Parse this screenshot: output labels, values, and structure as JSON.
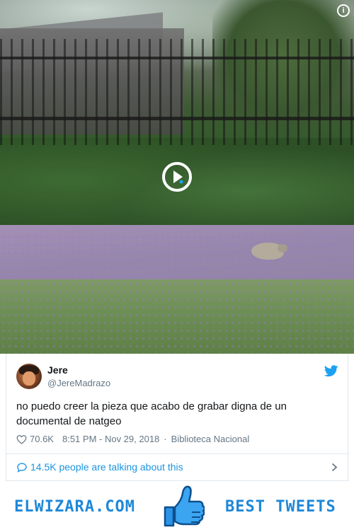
{
  "media": {
    "play_icon": "play-icon",
    "info_label": "i",
    "info_icon": "info-icon"
  },
  "tweet": {
    "display_name": "Jere",
    "handle": "@JereMadrazo",
    "text": "no puedo creer la pieza que acabo de grabar digna de un documental de natgeo",
    "likes": "70.6K",
    "time": "8:51 PM - Nov 29, 2018",
    "separator": "·",
    "location": "Biblioteca Nacional",
    "talking": "14.5K people are talking about this",
    "icons": [
      "twitter-bird-icon",
      "heart-icon",
      "speech-bubble-icon",
      "chevron-right-icon"
    ]
  },
  "banner": {
    "left_text": "ELWIZARA.COM",
    "right_text": "BEST TWEETS",
    "icon": "thumbs-up-icon"
  },
  "colors": {
    "link_blue": "#1b95e0",
    "banner_blue": "#1e88d8",
    "muted_gray": "#657786"
  }
}
